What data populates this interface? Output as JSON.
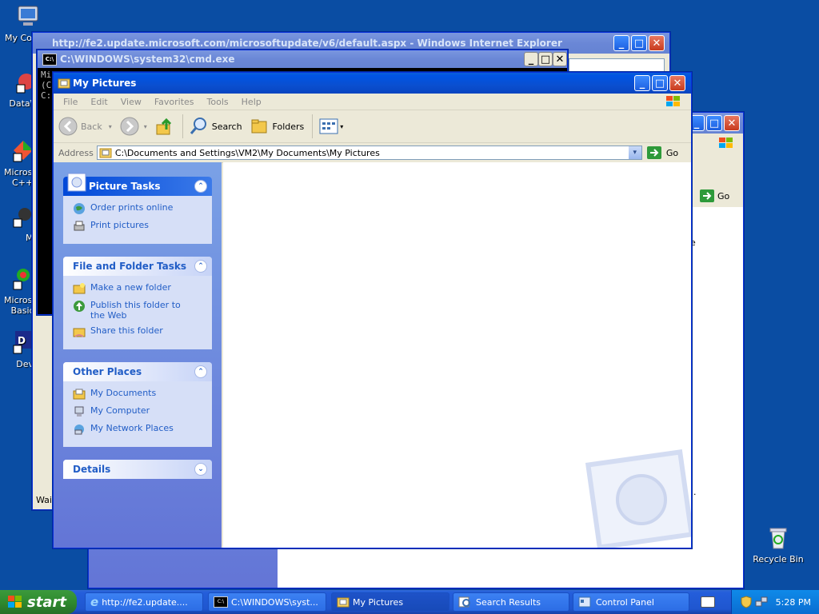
{
  "desktop": {
    "icons": [
      {
        "label": "My Com",
        "icon": "my-computer-icon"
      },
      {
        "label": "DataWa",
        "icon": "datawa-icon"
      },
      {
        "label": "Microsof C++",
        "icon": "visual-cpp-icon"
      },
      {
        "label": "My",
        "icon": "my-app-icon"
      },
      {
        "label": "Microsof Basic",
        "icon": "visual-basic-icon"
      },
      {
        "label": "Dev-",
        "icon": "dev-cpp-icon"
      },
      {
        "label": "Recycle Bin",
        "icon": "recycle-bin-icon"
      }
    ]
  },
  "ie_window": {
    "title": "http://fe2.update.microsoft.com/microsoftupdate/v6/default.aspx - Windows Internet Explorer",
    "status": "Wait"
  },
  "cmd_window": {
    "title": "C:\\WINDOWS\\system32\\cmd.exe",
    "lines": [
      "Mi",
      "(C",
      "C:"
    ]
  },
  "search_window": {
    "go_label": "Go",
    "side_text_1": "e",
    "side_text_2": "."
  },
  "explorer": {
    "title": "My Pictures",
    "menu": [
      "File",
      "Edit",
      "View",
      "Favorites",
      "Tools",
      "Help"
    ],
    "toolbar": {
      "back": "Back",
      "search": "Search",
      "folders": "Folders"
    },
    "address_label": "Address",
    "address_value": "C:\\Documents and Settings\\VM2\\My Documents\\My Pictures",
    "go_label": "Go",
    "panels": [
      {
        "title": "Picture Tasks",
        "items": [
          "Order prints online",
          "Print pictures"
        ]
      },
      {
        "title": "File and Folder Tasks",
        "items": [
          "Make a new folder",
          "Publish this folder to the Web",
          "Share this folder"
        ]
      },
      {
        "title": "Other Places",
        "items": [
          "My Documents",
          "My Computer",
          "My Network Places"
        ]
      },
      {
        "title": "Details",
        "items": []
      }
    ]
  },
  "taskbar": {
    "start_label": "start",
    "buttons": [
      "http://fe2.update....",
      "C:\\WINDOWS\\syst...",
      "My Pictures",
      "Search Results",
      "Control Panel"
    ],
    "clock": "5:28 PM"
  },
  "colors": {
    "desktop": "#0a4da3",
    "title_active": "#0054e3",
    "link_blue": "#215dc6"
  }
}
